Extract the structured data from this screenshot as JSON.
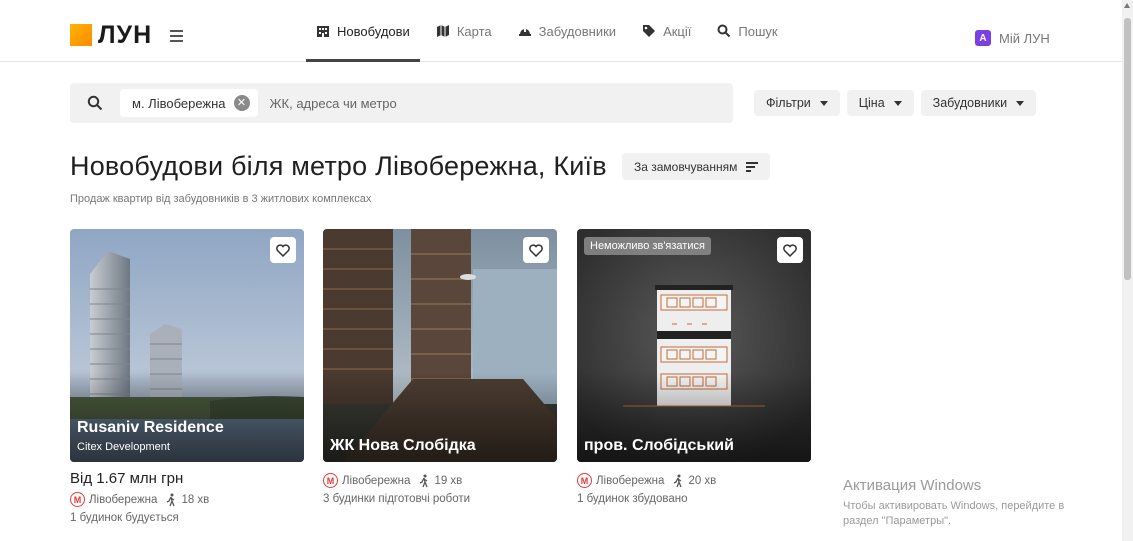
{
  "header": {
    "logo_text": "ЛУН",
    "nav": [
      {
        "label": "Новобудови",
        "icon": "building-icon",
        "active": true
      },
      {
        "label": "Карта",
        "icon": "map-icon",
        "active": false
      },
      {
        "label": "Забудовники",
        "icon": "helmet-icon",
        "active": false
      },
      {
        "label": "Акції",
        "icon": "tag-icon",
        "active": false
      },
      {
        "label": "Пошук",
        "icon": "search-icon",
        "active": false
      }
    ],
    "profile_badge": "A",
    "profile_label": "Мій ЛУН"
  },
  "search": {
    "chip_label": "м. Лівобережна",
    "placeholder": "ЖК, адреса чи метро"
  },
  "filters": [
    "Фільтри",
    "Ціна",
    "Забудовники"
  ],
  "page": {
    "title": "Новобудови біля метро Лівобережна, Київ",
    "sort_label": "За замовчуванням",
    "subtitle": "Продаж квартир від забудовників в 3 житлових комплексах"
  },
  "cards": [
    {
      "name": "Rusaniv Residence",
      "developer": "Citex Development",
      "price": "Від 1.67 млн грн",
      "metro": "Лівобережна",
      "walk": "18 хв",
      "status": "1 будинок будується"
    },
    {
      "name": "ЖК Нова Слобідка",
      "metro": "Лівобережна",
      "walk": "19 хв",
      "status": "3 будинки підготовчі роботи"
    },
    {
      "name": "пров. Слобідський",
      "badge": "Неможливо зв'язатися",
      "metro": "Лівобережна",
      "walk": "20 хв",
      "status": "1 будинок збудовано"
    }
  ],
  "metro_letter": "М",
  "windows_watermark": {
    "title": "Активация Windows",
    "line1": "Чтобы активировать Windows, перейдите в",
    "line2": "раздел \"Параметры\"."
  },
  "colors": {
    "accent": "#ff9800",
    "metro_red": "#e53935",
    "profile_purple": "#7b3fe4"
  }
}
